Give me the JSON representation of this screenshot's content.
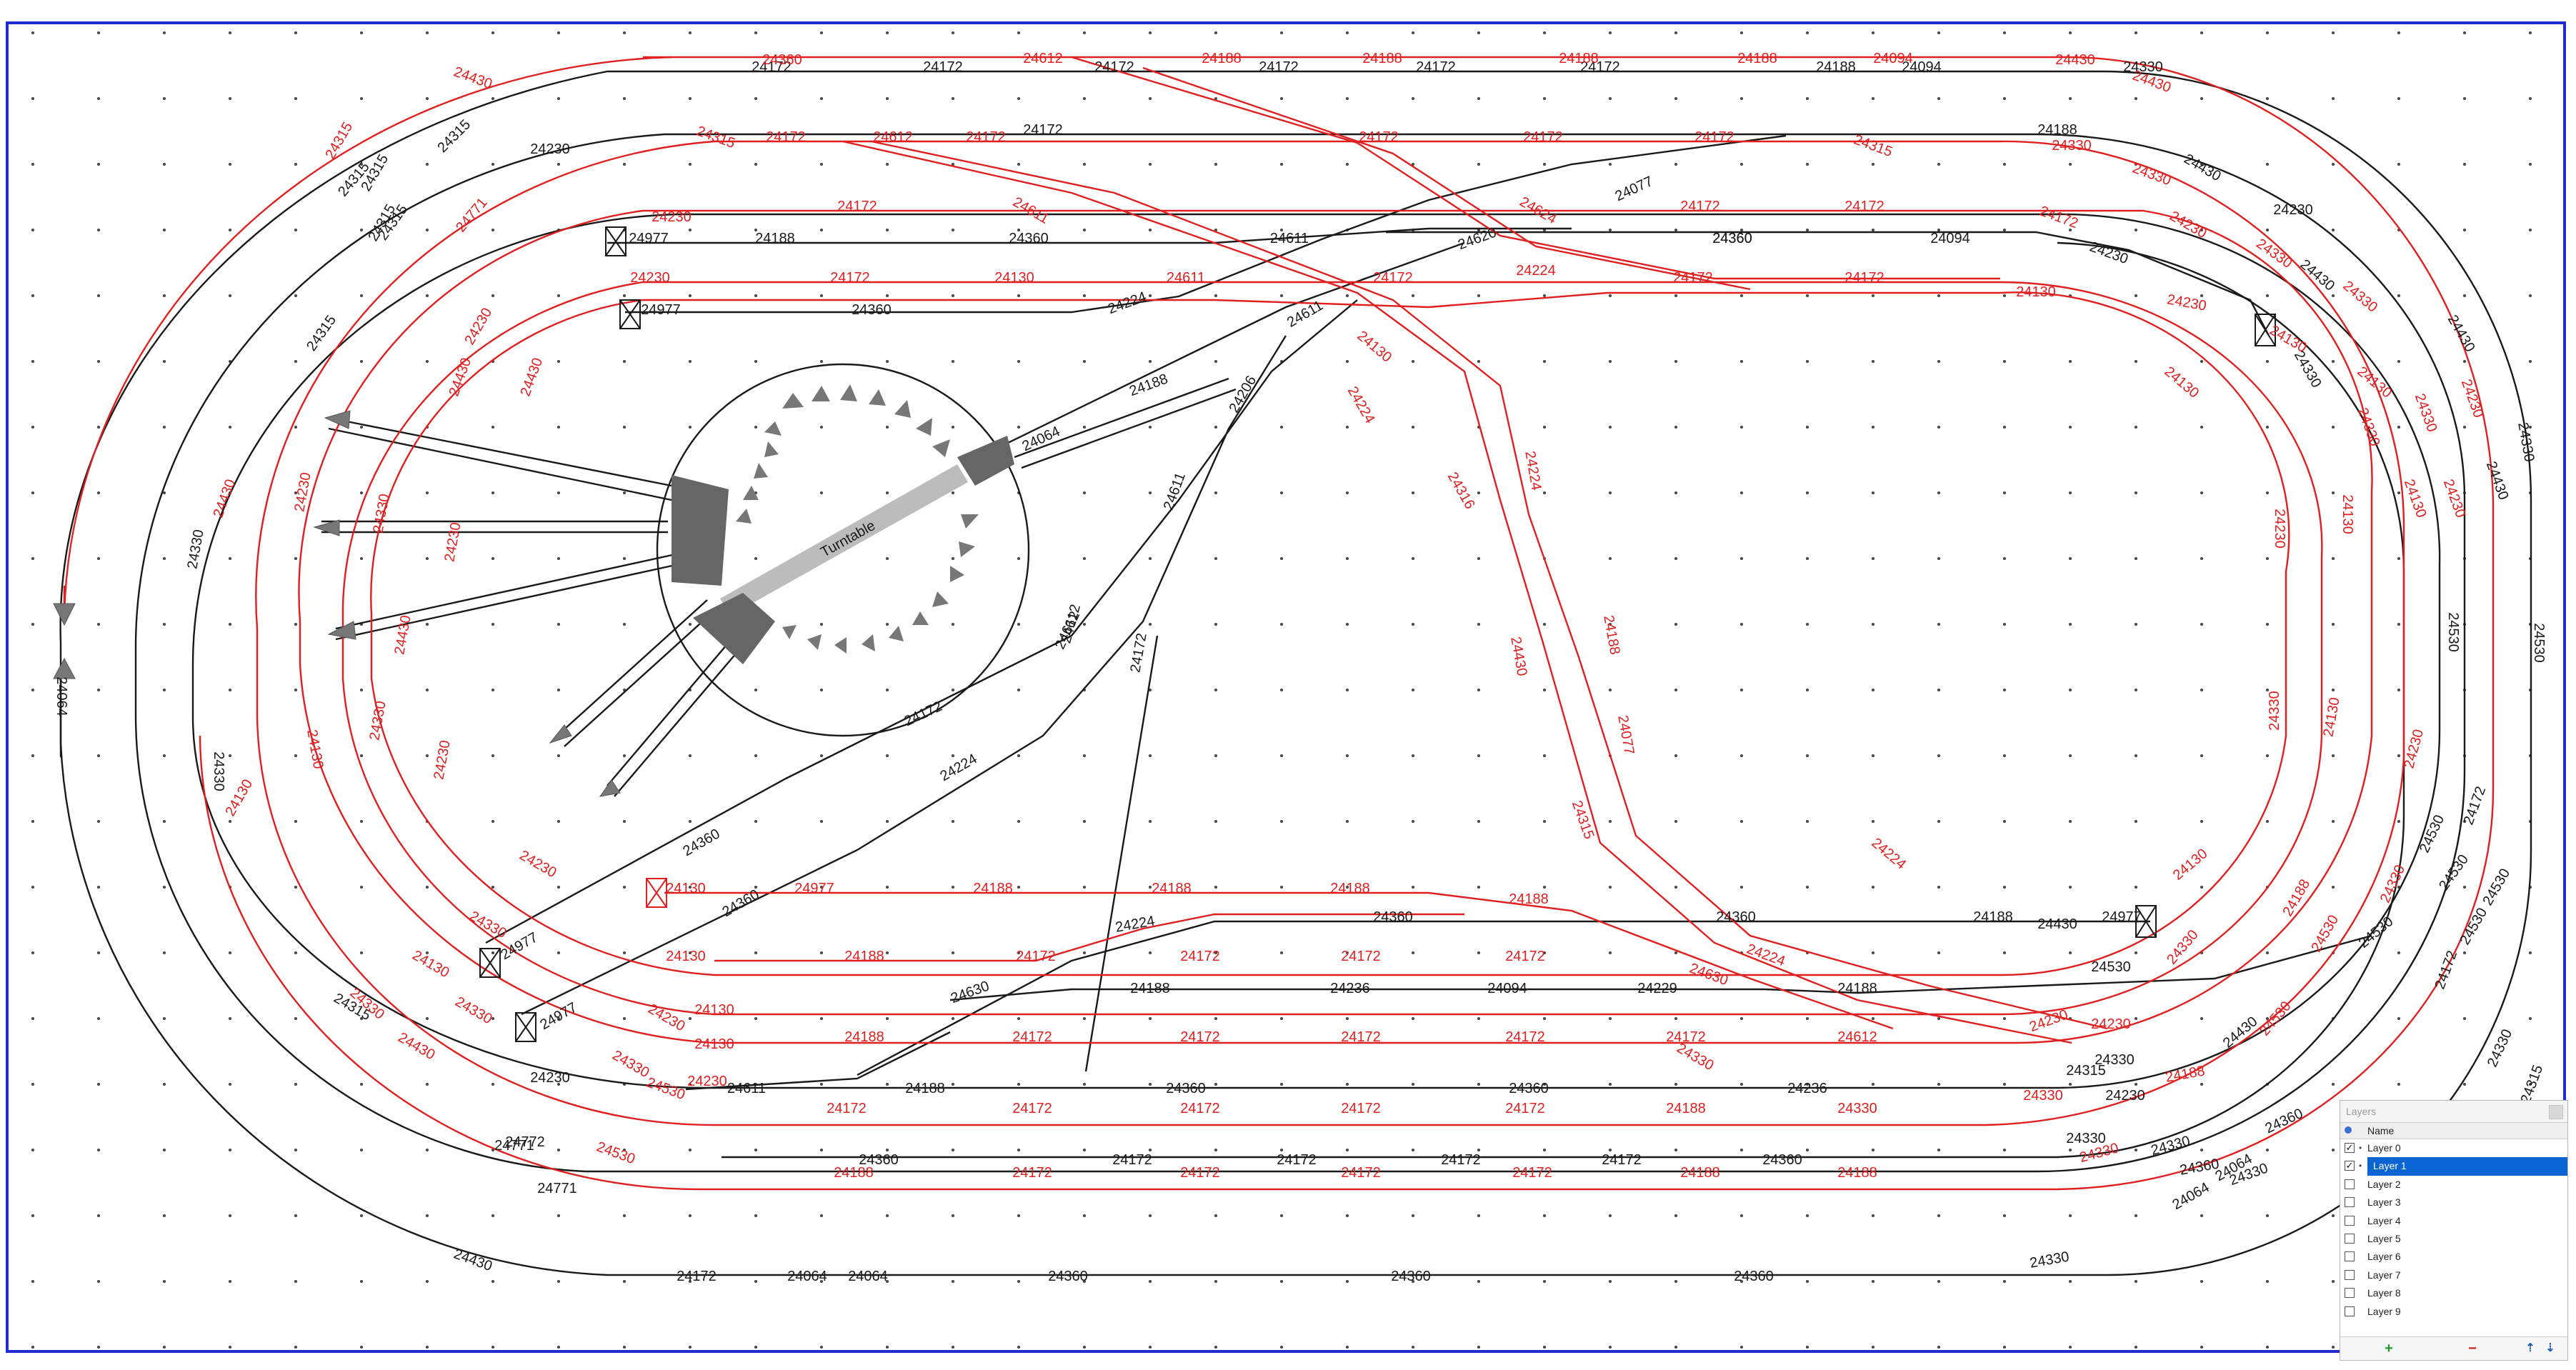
{
  "colors": {
    "frame": "#1f2ad1",
    "track_black": "#1a1a1a",
    "track_red": "#e02020",
    "selection": "#0a64d2"
  },
  "turntable": {
    "label": "Turntable"
  },
  "labels_black": [
    "24172",
    "24172",
    "24172",
    "24172",
    "24172",
    "24172",
    "24188",
    "24094",
    "24188",
    "24172",
    "24230",
    "24315",
    "24315",
    "24315",
    "24315",
    "24360",
    "24977",
    "24188",
    "24360",
    "24611",
    "24360",
    "24094",
    "24230",
    "24977",
    "24360",
    "24224",
    "24611",
    "24188",
    "24064",
    "24077",
    "24620",
    "24206",
    "24611",
    "24612",
    "24172",
    "24172",
    "24224",
    "24360",
    "24360",
    "24977",
    "24977",
    "24230",
    "24630",
    "24188",
    "24236",
    "24094",
    "24229",
    "24188",
    "24224",
    "24360",
    "24360",
    "24188",
    "24977",
    "24611",
    "24188",
    "24360",
    "24360",
    "24236",
    "24772",
    "24360",
    "24172",
    "24172",
    "24172",
    "24172",
    "24360",
    "24430",
    "24172",
    "24064",
    "24064",
    "24360",
    "24360",
    "24360",
    "24330",
    "24064",
    "24064",
    "24330",
    "24330",
    "24315",
    "24330",
    "24530",
    "24530",
    "24530",
    "24530",
    "24530",
    "24172",
    "24330",
    "24330",
    "24430",
    "24430",
    "24430",
    "24430",
    "24315",
    "24315",
    "24315",
    "24230",
    "24771",
    "24771",
    "24330",
    "24330",
    "24330",
    "24064",
    "24530",
    "24530",
    "24172",
    "24315",
    "24330",
    "24330",
    "24330",
    "24530",
    "24612",
    "24230",
    "24360",
    "24360",
    "24330",
    "24430",
    "24430"
  ],
  "labels_red": [
    "24430",
    "24360",
    "24612",
    "24188",
    "24188",
    "24188",
    "24188",
    "24094",
    "24430",
    "24430",
    "24315",
    "24612",
    "24172",
    "24172",
    "24172",
    "24172",
    "24172",
    "24315",
    "24315",
    "24330",
    "24330",
    "24771",
    "24230",
    "24172",
    "24611",
    "24624",
    "24172",
    "24172",
    "24172",
    "24230",
    "24230",
    "24130",
    "24172",
    "24172",
    "24611",
    "24224",
    "24172",
    "24172",
    "24130",
    "24330",
    "24230",
    "24430",
    "24130",
    "24130",
    "24224",
    "24316",
    "24224",
    "24430",
    "24188",
    "24077",
    "24315",
    "24224",
    "24130",
    "24130",
    "24977",
    "24188",
    "24188",
    "24188",
    "24188",
    "24224",
    "24130",
    "24188",
    "24172",
    "24172",
    "24172",
    "24172",
    "24630",
    "24230",
    "24188",
    "24172",
    "24172",
    "24172",
    "24172",
    "24172",
    "24612",
    "24230",
    "24330",
    "24188",
    "24172",
    "24172",
    "24172",
    "24172",
    "24172",
    "24188",
    "24330",
    "24330",
    "24188",
    "24188",
    "24172",
    "24172",
    "24172",
    "24172",
    "24188",
    "24188",
    "24330",
    "24530",
    "24530",
    "24330",
    "24230",
    "24130",
    "24330",
    "24230",
    "24130",
    "24130",
    "24230",
    "24330",
    "24330",
    "24230",
    "24130",
    "24130",
    "24230",
    "24330",
    "24430",
    "24430",
    "24330",
    "24230",
    "24130",
    "24230",
    "24330",
    "24230",
    "24130",
    "24230",
    "24330",
    "24130",
    "24230",
    "24330",
    "24430",
    "24330",
    "24530",
    "24530",
    "24330",
    "24130",
    "24130",
    "24230",
    "24330",
    "24430"
  ],
  "layers_panel": {
    "title": "Layers",
    "column_name": "Name",
    "layers": [
      {
        "name": "Layer 0",
        "checked": true,
        "selected": false
      },
      {
        "name": "Layer 1",
        "checked": true,
        "selected": true
      },
      {
        "name": "Layer 2",
        "checked": false,
        "selected": false
      },
      {
        "name": "Layer 3",
        "checked": false,
        "selected": false
      },
      {
        "name": "Layer 4",
        "checked": false,
        "selected": false
      },
      {
        "name": "Layer 5",
        "checked": false,
        "selected": false
      },
      {
        "name": "Layer 6",
        "checked": false,
        "selected": false
      },
      {
        "name": "Layer 7",
        "checked": false,
        "selected": false
      },
      {
        "name": "Layer 8",
        "checked": false,
        "selected": false
      },
      {
        "name": "Layer 9",
        "checked": false,
        "selected": false
      }
    ],
    "toolbar": {
      "add_icon": "plus-icon",
      "remove_icon": "minus-icon",
      "up_icon": "arrow-up-icon",
      "down_icon": "arrow-down-icon"
    }
  }
}
